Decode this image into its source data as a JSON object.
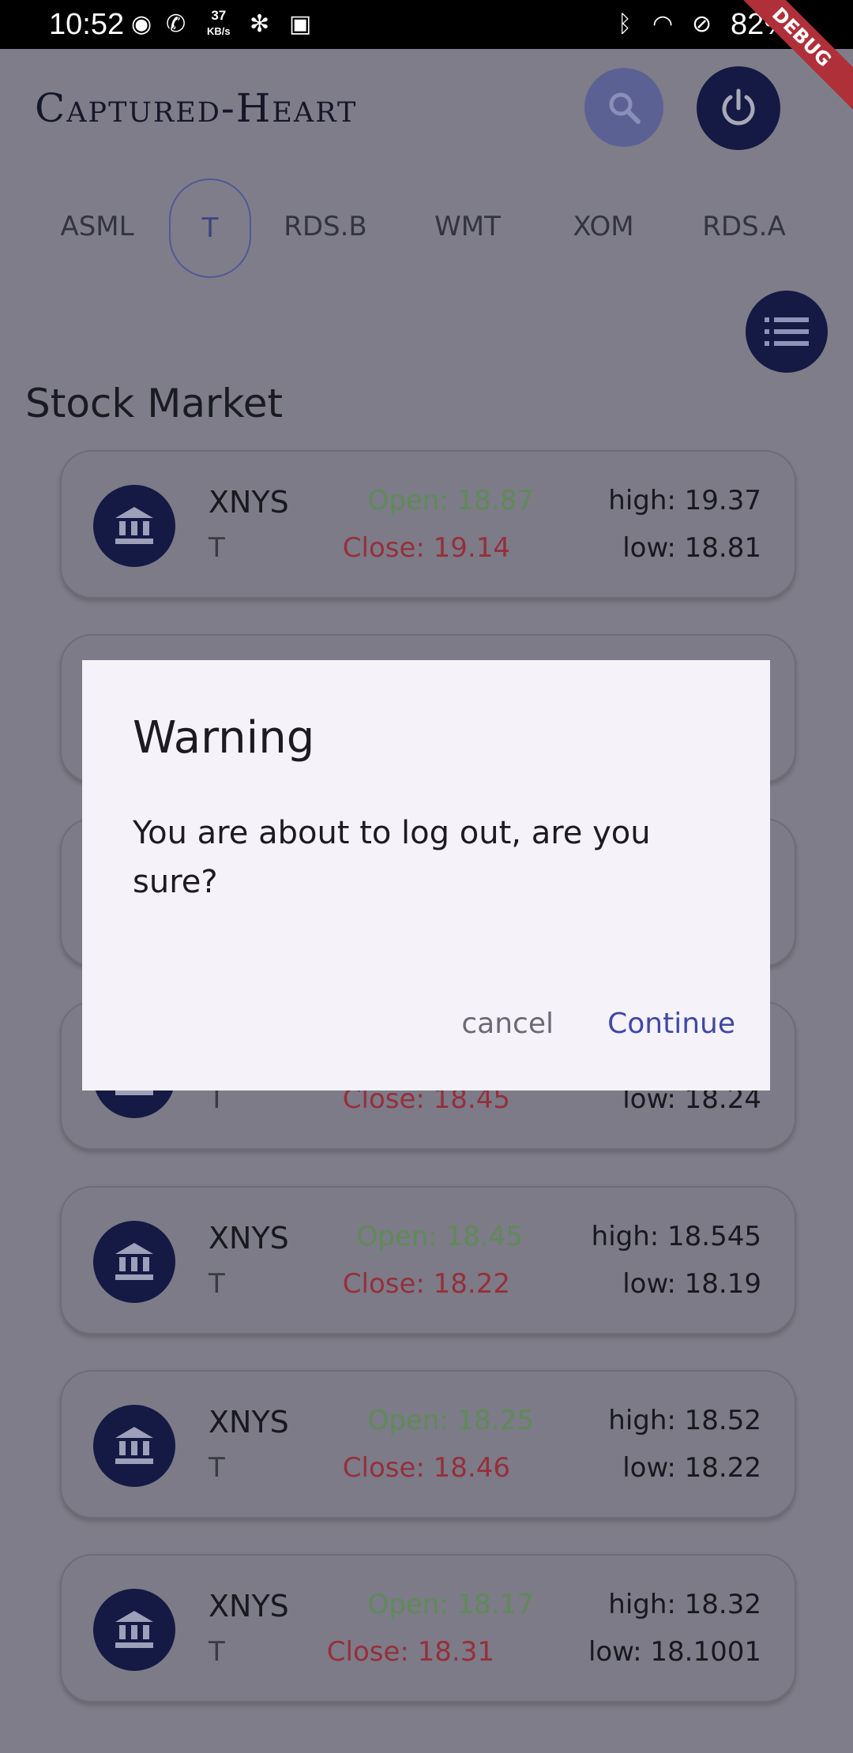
{
  "status_bar": {
    "time": "10:52",
    "speed_value": "37",
    "speed_unit": "KB/s",
    "battery": "82%",
    "debug_label": "DEBUG"
  },
  "app": {
    "title": "Captured-Heart"
  },
  "tabs": [
    "ASML",
    "T",
    "RDS.B",
    "WMT",
    "XOM",
    "RDS.A"
  ],
  "active_tab": "T",
  "section_title": "Stock Market",
  "cards": [
    {
      "exchange": "XNYS",
      "symbol": "T",
      "open": "Open: 18.87",
      "close": "Close: 19.14",
      "high": "high: 19.37",
      "low": "low: 18.81"
    },
    {
      "exchange": "",
      "symbol": "",
      "open": "",
      "close": "",
      "high": "",
      "low": ""
    },
    {
      "exchange": "",
      "symbol": "",
      "open": "",
      "close": "",
      "high": "",
      "low": ""
    },
    {
      "exchange": "",
      "symbol": "T",
      "open": "",
      "close": "Close: 18.45",
      "high": "",
      "low": "low: 18.24"
    },
    {
      "exchange": "XNYS",
      "symbol": "T",
      "open": "Open: 18.45",
      "close": "Close: 18.22",
      "high": "high: 18.545",
      "low": "low: 18.19"
    },
    {
      "exchange": "XNYS",
      "symbol": "T",
      "open": "Open: 18.25",
      "close": "Close: 18.46",
      "high": "high: 18.52",
      "low": "low: 18.22"
    },
    {
      "exchange": "XNYS",
      "symbol": "T",
      "open": "Open: 18.17",
      "close": "Close: 18.31",
      "high": "high: 18.32",
      "low": "low: 18.1001"
    }
  ],
  "dialog": {
    "title": "Warning",
    "message": "You are about to log out, are you sure?",
    "cancel_label": "cancel",
    "continue_label": "Continue"
  },
  "colors": {
    "primary_dark": "#141a44",
    "accent": "#3f48a8",
    "open_green": "#5f8a58",
    "close_red": "#962f3b"
  }
}
